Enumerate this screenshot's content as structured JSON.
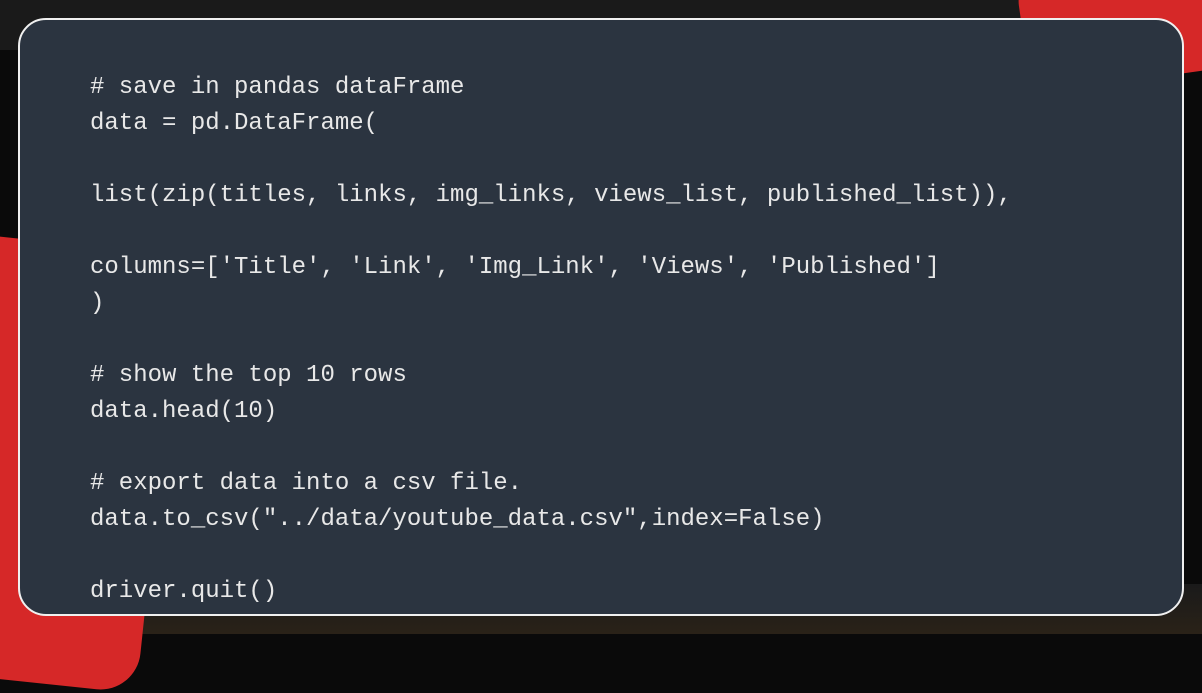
{
  "code": {
    "line1": "# save in pandas dataFrame",
    "line2": "data = pd.DataFrame(",
    "line3": "list(zip(titles, links, img_links, views_list, published_list)),",
    "line4": "columns=['Title', 'Link', 'Img_Link', 'Views', 'Published']",
    "line5": ")",
    "line6": "# show the top 10 rows",
    "line7": "data.head(10)",
    "line8": "# export data into a csv file.",
    "line9": "data.to_csv(\"../data/youtube_data.csv\",index=False)",
    "line10": "driver.quit()"
  }
}
